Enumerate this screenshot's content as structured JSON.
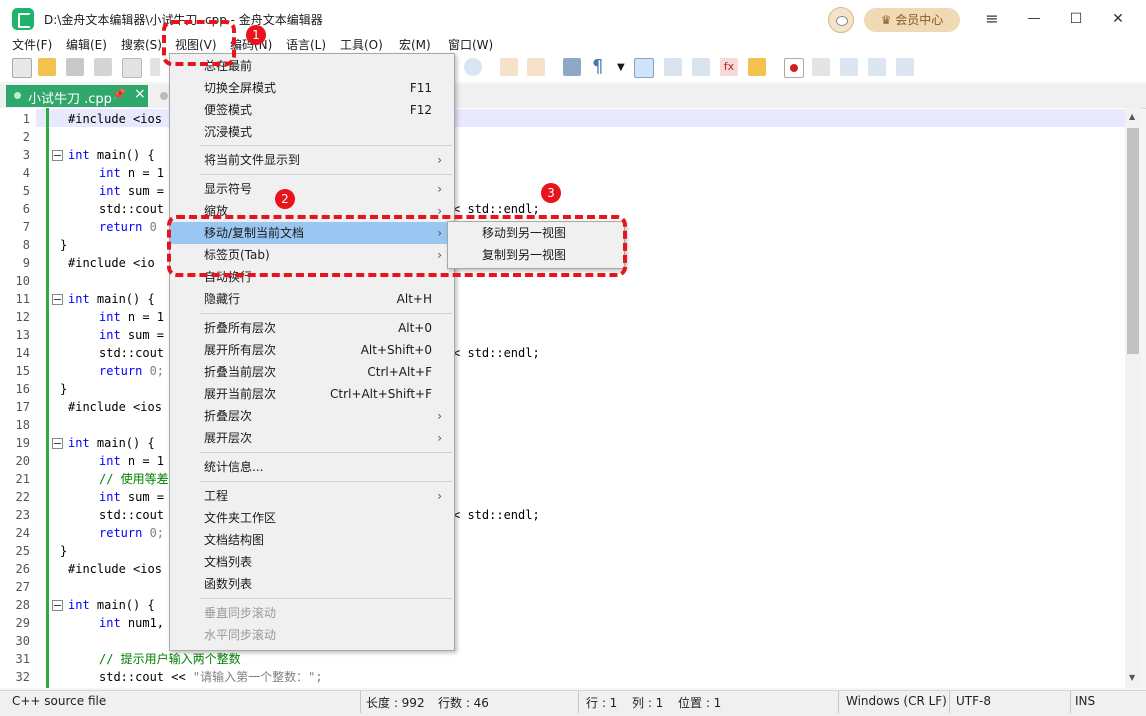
{
  "window": {
    "title": "D:\\金舟文本编辑器\\小试牛刀 .cpp - 金舟文本编辑器",
    "member_button": "会员中心",
    "controls": [
      "≡",
      "—",
      "☐",
      "✕"
    ]
  },
  "menubar": {
    "items": [
      "文件(F)",
      "编辑(E)",
      "搜索(S)",
      "视图(V)",
      "编码(N)",
      "语言(L)",
      "工具(O)",
      "宏(M)",
      "窗口(W)"
    ]
  },
  "tab": {
    "active_label": "小试牛刀 .cpp",
    "pin_icon": "📌",
    "close_icon": "×"
  },
  "line_numbers": [
    "1",
    "2",
    "3",
    "4",
    "5",
    "6",
    "7",
    "8",
    "9",
    "10",
    "11",
    "12",
    "13",
    "14",
    "15",
    "16",
    "17",
    "18",
    "19",
    "20",
    "21",
    "22",
    "23",
    "24",
    "25",
    "26",
    "27",
    "28",
    "29",
    "30",
    "31",
    "32"
  ],
  "code_lines": {
    "l1": "#include <ios",
    "l3a": "int",
    "l3b": " main() {",
    "l4a": "int",
    "l4b": " n = 1",
    "l5a": "int",
    "l5b": " sum =",
    "l6": "std::cout",
    "l6r": "< std::endl;",
    "l7a": "return",
    "l7b": " 0",
    "l8": "}",
    "l9": "#include <io",
    "l11a": "int",
    "l11b": " main() {",
    "l12a": "int",
    "l12b": " n = 1",
    "l13a": "int",
    "l13b": " sum =",
    "l14": "std::cout",
    "l14r": "< std::endl;",
    "l15a": "return",
    "l15b": " 0;",
    "l16": "}",
    "l17": "#include <ios",
    "l19a": "int",
    "l19b": " main() {",
    "l20a": "int",
    "l20b": " n = 1",
    "l21": "// 使用等差",
    "l22a": "int",
    "l22b": " sum =",
    "l23": "std::cout",
    "l23r": "< std::endl;",
    "l24a": "return",
    "l24b": " 0;",
    "l25": "}",
    "l26": "#include <ios",
    "l28a": "int",
    "l28b": " main() {",
    "l29a": "int",
    "l29b": " num1,",
    "l31": "// 提示用户输入两个整数",
    "l32a": "std::cout << ",
    "l32b": "\"请输入第一个整数：\";"
  },
  "view_menu": {
    "items": [
      {
        "label": "总在最前",
        "shortcut": "",
        "arrow": false
      },
      {
        "label": "切换全屏模式",
        "shortcut": "F11",
        "arrow": false
      },
      {
        "label": "便签模式",
        "shortcut": "F12",
        "arrow": false
      },
      {
        "label": "沉浸模式",
        "shortcut": "",
        "arrow": false
      },
      {
        "label": "将当前文件显示到",
        "shortcut": "",
        "arrow": true
      },
      {
        "label": "显示符号",
        "shortcut": "",
        "arrow": true
      },
      {
        "label": "缩放",
        "shortcut": "",
        "arrow": true
      },
      {
        "label": "移动/复制当前文档",
        "shortcut": "",
        "arrow": true
      },
      {
        "label": "标签页(Tab)",
        "shortcut": "",
        "arrow": true
      },
      {
        "label": "自动换行",
        "shortcut": "",
        "arrow": false
      },
      {
        "label": "隐藏行",
        "shortcut": "Alt+H",
        "arrow": false
      },
      {
        "label": "折叠所有层次",
        "shortcut": "Alt+0",
        "arrow": false
      },
      {
        "label": "展开所有层次",
        "shortcut": "Alt+Shift+0",
        "arrow": false
      },
      {
        "label": "折叠当前层次",
        "shortcut": "Ctrl+Alt+F",
        "arrow": false
      },
      {
        "label": "展开当前层次",
        "shortcut": "Ctrl+Alt+Shift+F",
        "arrow": false
      },
      {
        "label": "折叠层次",
        "shortcut": "",
        "arrow": true
      },
      {
        "label": "展开层次",
        "shortcut": "",
        "arrow": true
      },
      {
        "label": "统计信息...",
        "shortcut": "",
        "arrow": false
      },
      {
        "label": "工程",
        "shortcut": "",
        "arrow": true
      },
      {
        "label": "文件夹工作区",
        "shortcut": "",
        "arrow": false
      },
      {
        "label": "文档结构图",
        "shortcut": "",
        "arrow": false
      },
      {
        "label": "文档列表",
        "shortcut": "",
        "arrow": false
      },
      {
        "label": "函数列表",
        "shortcut": "",
        "arrow": false
      },
      {
        "label": "垂直同步滚动",
        "shortcut": "",
        "arrow": false
      },
      {
        "label": "水平同步滚动",
        "shortcut": "",
        "arrow": false
      }
    ],
    "arrow_glyph": "›"
  },
  "submenu": {
    "items": [
      "移动到另一视图",
      "复制到另一视图"
    ]
  },
  "annotations": {
    "badges": [
      "1",
      "2",
      "3"
    ],
    "color": "#e8131b"
  },
  "statusbar": {
    "file_type": "C++ source file",
    "length": "长度 : 992",
    "lines": "行数 : 46",
    "row": "行 : 1",
    "col": "列 : 1",
    "pos": "位置 : 1",
    "eol": "Windows (CR LF)",
    "encoding": "UTF-8",
    "mode": "INS"
  },
  "colors": {
    "accent_green": "#31a86b",
    "menu_highlight": "#99c7f2",
    "annotation_red": "#e8131b"
  }
}
